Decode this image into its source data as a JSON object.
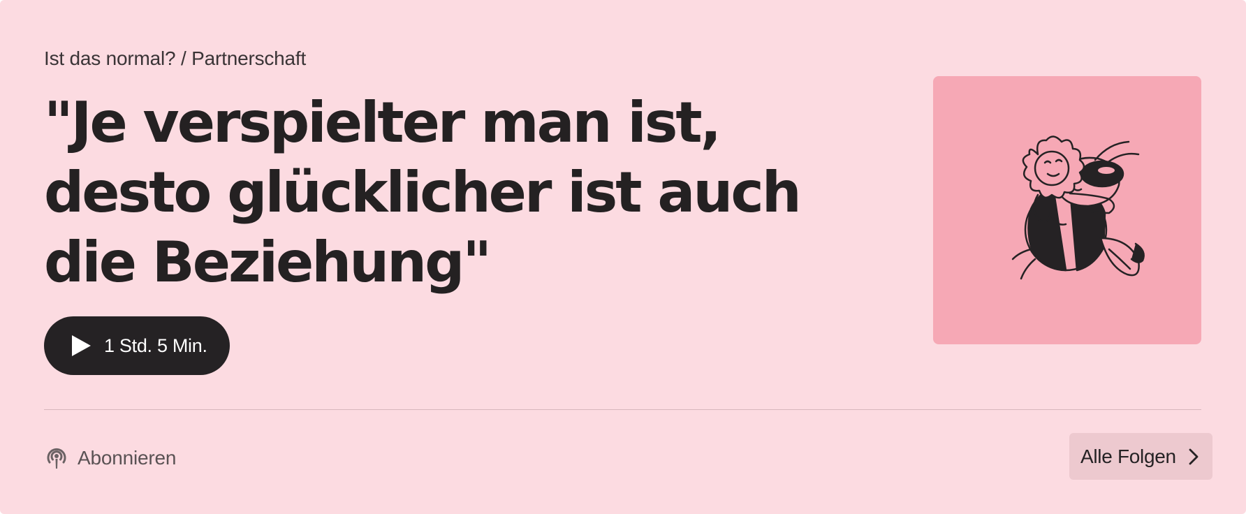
{
  "episode": {
    "breadcrumb": "Ist das normal? / Partnerschaft",
    "title": "\"Je verspielter man ist, desto glücklicher ist auch die Beziehung\"",
    "duration": "1 Std. 5 Min."
  },
  "footer": {
    "subscribe_label": "Abonnieren",
    "all_episodes_label": "Alle Folgen"
  },
  "icons": {
    "play": "play-icon",
    "podcast": "podcast-icon",
    "chevron": "chevron-right-icon",
    "artwork": "flower-bee-illustration"
  },
  "colors": {
    "background": "#fcdbe1",
    "artwork_background": "#f6a8b5",
    "dark": "#252224",
    "button_secondary": "#edc9cf"
  }
}
